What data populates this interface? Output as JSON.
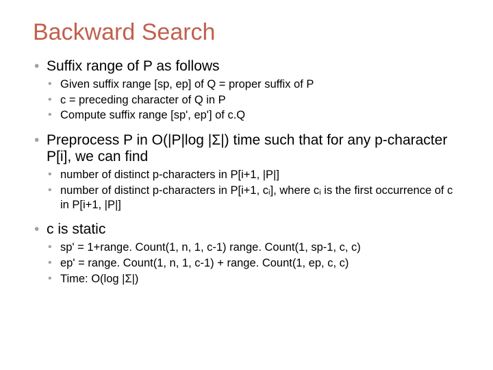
{
  "title": "Backward Search",
  "sections": [
    {
      "heading": "Suffix range of P as follows",
      "items": [
        "Given suffix range [sp, ep] of Q = proper suffix of P",
        "c = preceding character of Q in P",
        "Compute suffix range [sp', ep'] of c.Q"
      ]
    },
    {
      "heading": "Preprocess P in O(|P|log |Σ|) time such that for any p-character P[i], we can find",
      "items": [
        "number of distinct p-characters in P[i+1, |P|]",
        "number of distinct p-characters in P[i+1, cᵢ], where cᵢ is the first occurrence of c in P[i+1, |P|]"
      ]
    },
    {
      "heading": "c is static",
      "items": [
        "sp' = 1+range. Count(1, n, 1, c-1) range. Count(1, sp-1, c, c)",
        "ep' = range. Count(1, n, 1, c-1) + range. Count(1, ep, c, c)",
        "Time: O(log |Σ|)"
      ]
    }
  ]
}
